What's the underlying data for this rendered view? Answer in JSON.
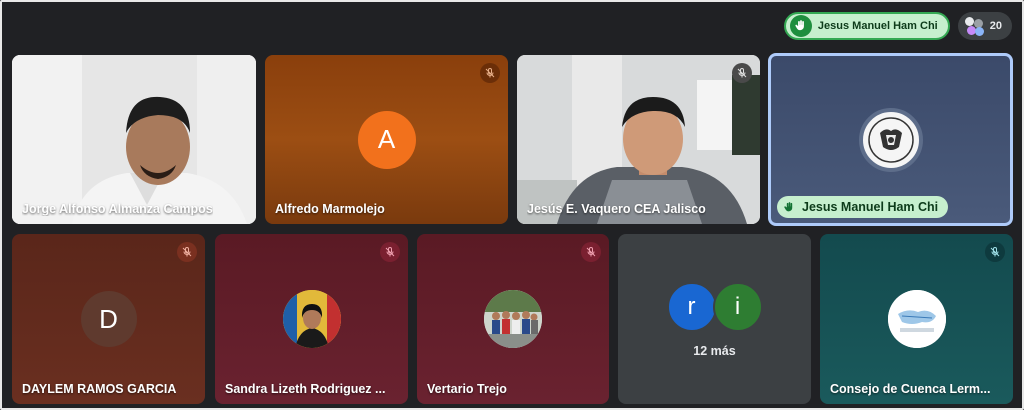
{
  "top_bar": {
    "raised_hand_name": "Jesus Manuel Ham Chi",
    "participant_count": "20"
  },
  "tiles": [
    {
      "name": "Jorge Alfonso Almanza Campos",
      "type": "video",
      "muted": false
    },
    {
      "name": "Alfredo Marmolejo",
      "type": "initial",
      "initial": "A",
      "avatar_color": "#f2711c",
      "muted": true
    },
    {
      "name": "Jesús E. Vaquero CEA Jalisco",
      "type": "video",
      "muted": true
    },
    {
      "name": "Jesus Manuel Ham Chi",
      "type": "emblem",
      "hand_raised": true,
      "muted": false
    },
    {
      "name": "DAYLEM RAMOS GARCIA",
      "type": "initial",
      "initial": "D",
      "avatar_color": "#5f3a2e",
      "muted": true
    },
    {
      "name": "Sandra Lizeth Rodriguez ...",
      "type": "photo",
      "muted": true
    },
    {
      "name": "Vertario Trejo",
      "type": "photo",
      "muted": true
    },
    {
      "type": "overflow",
      "initials": [
        "r",
        "i"
      ],
      "initial_colors": [
        "#1967d2",
        "#2e7d32"
      ],
      "more_label": "12 más"
    },
    {
      "name": "Consejo de Cuenca Lerm...",
      "type": "photo",
      "muted": true
    }
  ],
  "colors": {
    "background": "#202124",
    "hand_raise_green": "#34a853",
    "focus_ring": "#aecbfa"
  }
}
